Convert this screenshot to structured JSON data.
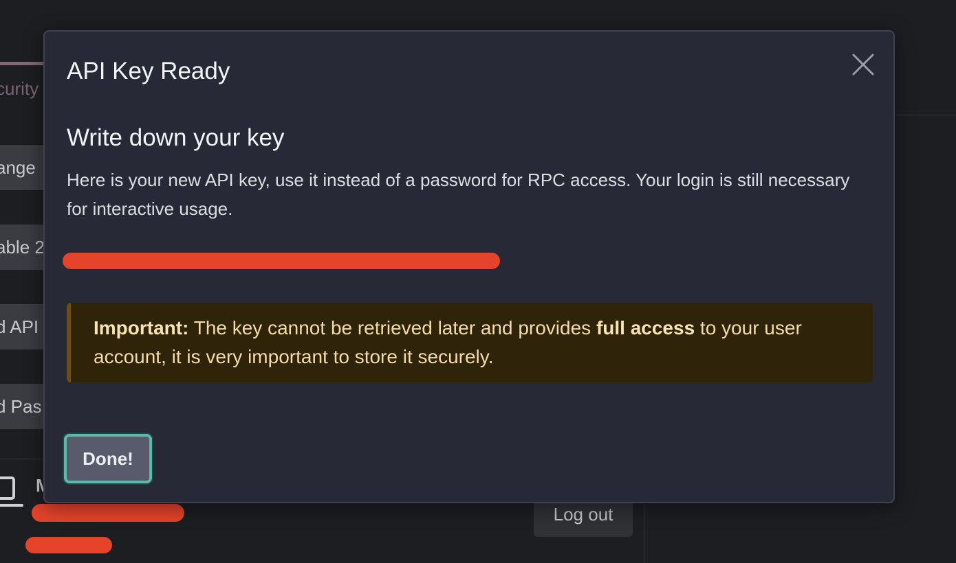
{
  "background": {
    "tab_fragment": "curity",
    "buttons": [
      "ange",
      "able 2",
      "d API",
      "d Pas"
    ],
    "device_name_fragment": "M",
    "logout_label": "Log out"
  },
  "modal": {
    "title": "API Key Ready",
    "close_icon": "close-icon",
    "section_title": "Write down your key",
    "description": "Here is your new API key, use it instead of a password for RPC access. Your login is still necessary for interactive usage.",
    "api_key": "",
    "alert": {
      "label": "Important:",
      "text_before": " The key cannot be retrieved later and provides ",
      "emphasis": "full access",
      "text_after": " to your user account, it is very important to store it securely."
    },
    "done_label": "Done!"
  },
  "colors": {
    "modal_bg": "#272a36",
    "alert_bg": "#2f2309",
    "alert_text": "#f4dca8",
    "done_border": "#5fb8ac",
    "redaction": "#e5432a"
  }
}
